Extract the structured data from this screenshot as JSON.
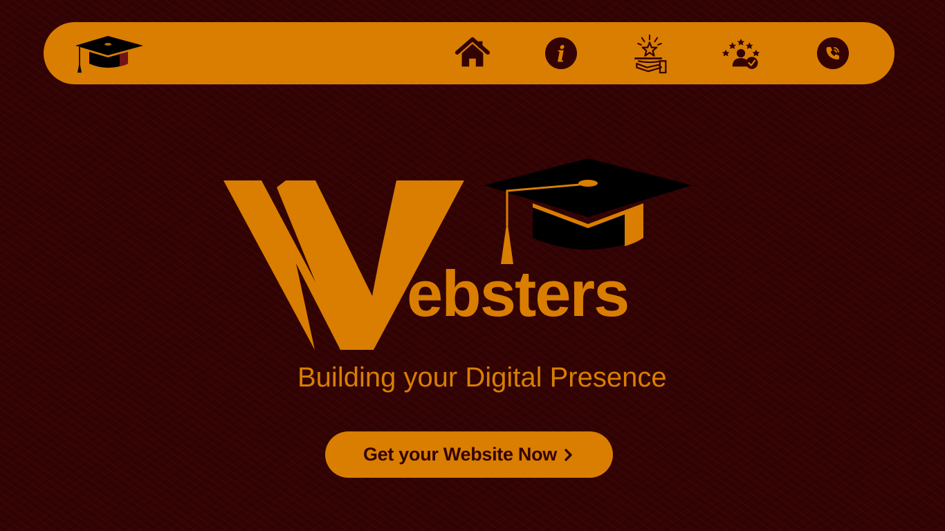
{
  "colors": {
    "background": "#330203",
    "accent": "#d97e00",
    "ink": "#000000"
  },
  "nav": {
    "logo_icon": "graduation-cap-icon",
    "items": [
      {
        "icon": "home-icon"
      },
      {
        "icon": "info-icon",
        "glyph": "i"
      },
      {
        "icon": "star-service-icon"
      },
      {
        "icon": "reviews-icon"
      },
      {
        "icon": "phone-icon"
      }
    ]
  },
  "hero": {
    "brand_initial": "W",
    "brand_rest": "ebsters",
    "tagline": "Building your Digital Presence",
    "cta_label": "Get your Website Now"
  }
}
